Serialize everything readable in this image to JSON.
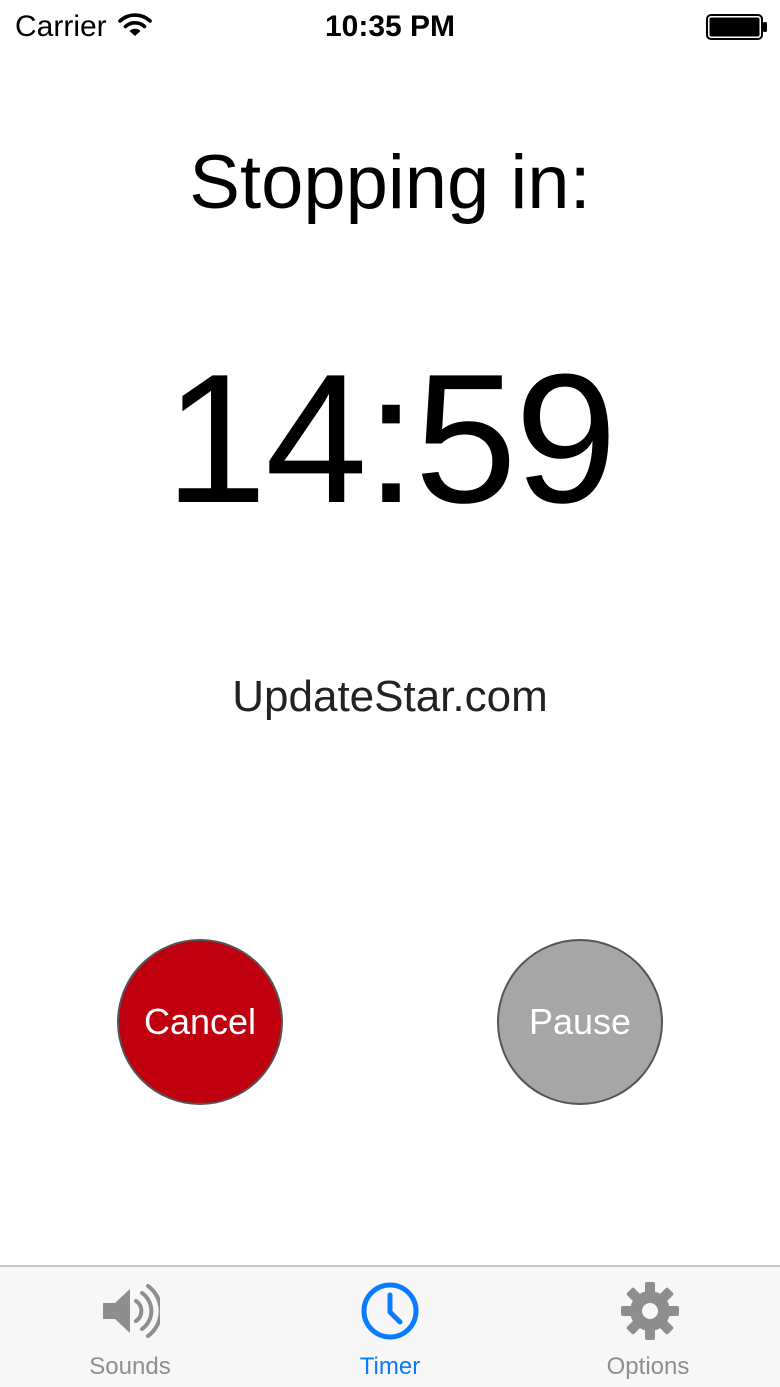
{
  "status_bar": {
    "carrier": "Carrier",
    "time": "10:35 PM"
  },
  "timer": {
    "heading": "Stopping in:",
    "remaining": "14:59"
  },
  "watermark": "UpdateStar.com",
  "buttons": {
    "cancel_label": "Cancel",
    "pause_label": "Pause"
  },
  "tab_bar": {
    "tabs": [
      {
        "label": "Sounds",
        "icon": "speaker-icon",
        "selected": false
      },
      {
        "label": "Timer",
        "icon": "clock-icon",
        "selected": true
      },
      {
        "label": "Options",
        "icon": "gear-icon",
        "selected": false
      }
    ]
  },
  "colors": {
    "cancel": "#c0000f",
    "pause": "#a6a6a6",
    "tab_active": "#0a7aff",
    "tab_inactive": "#8e8e8e"
  }
}
